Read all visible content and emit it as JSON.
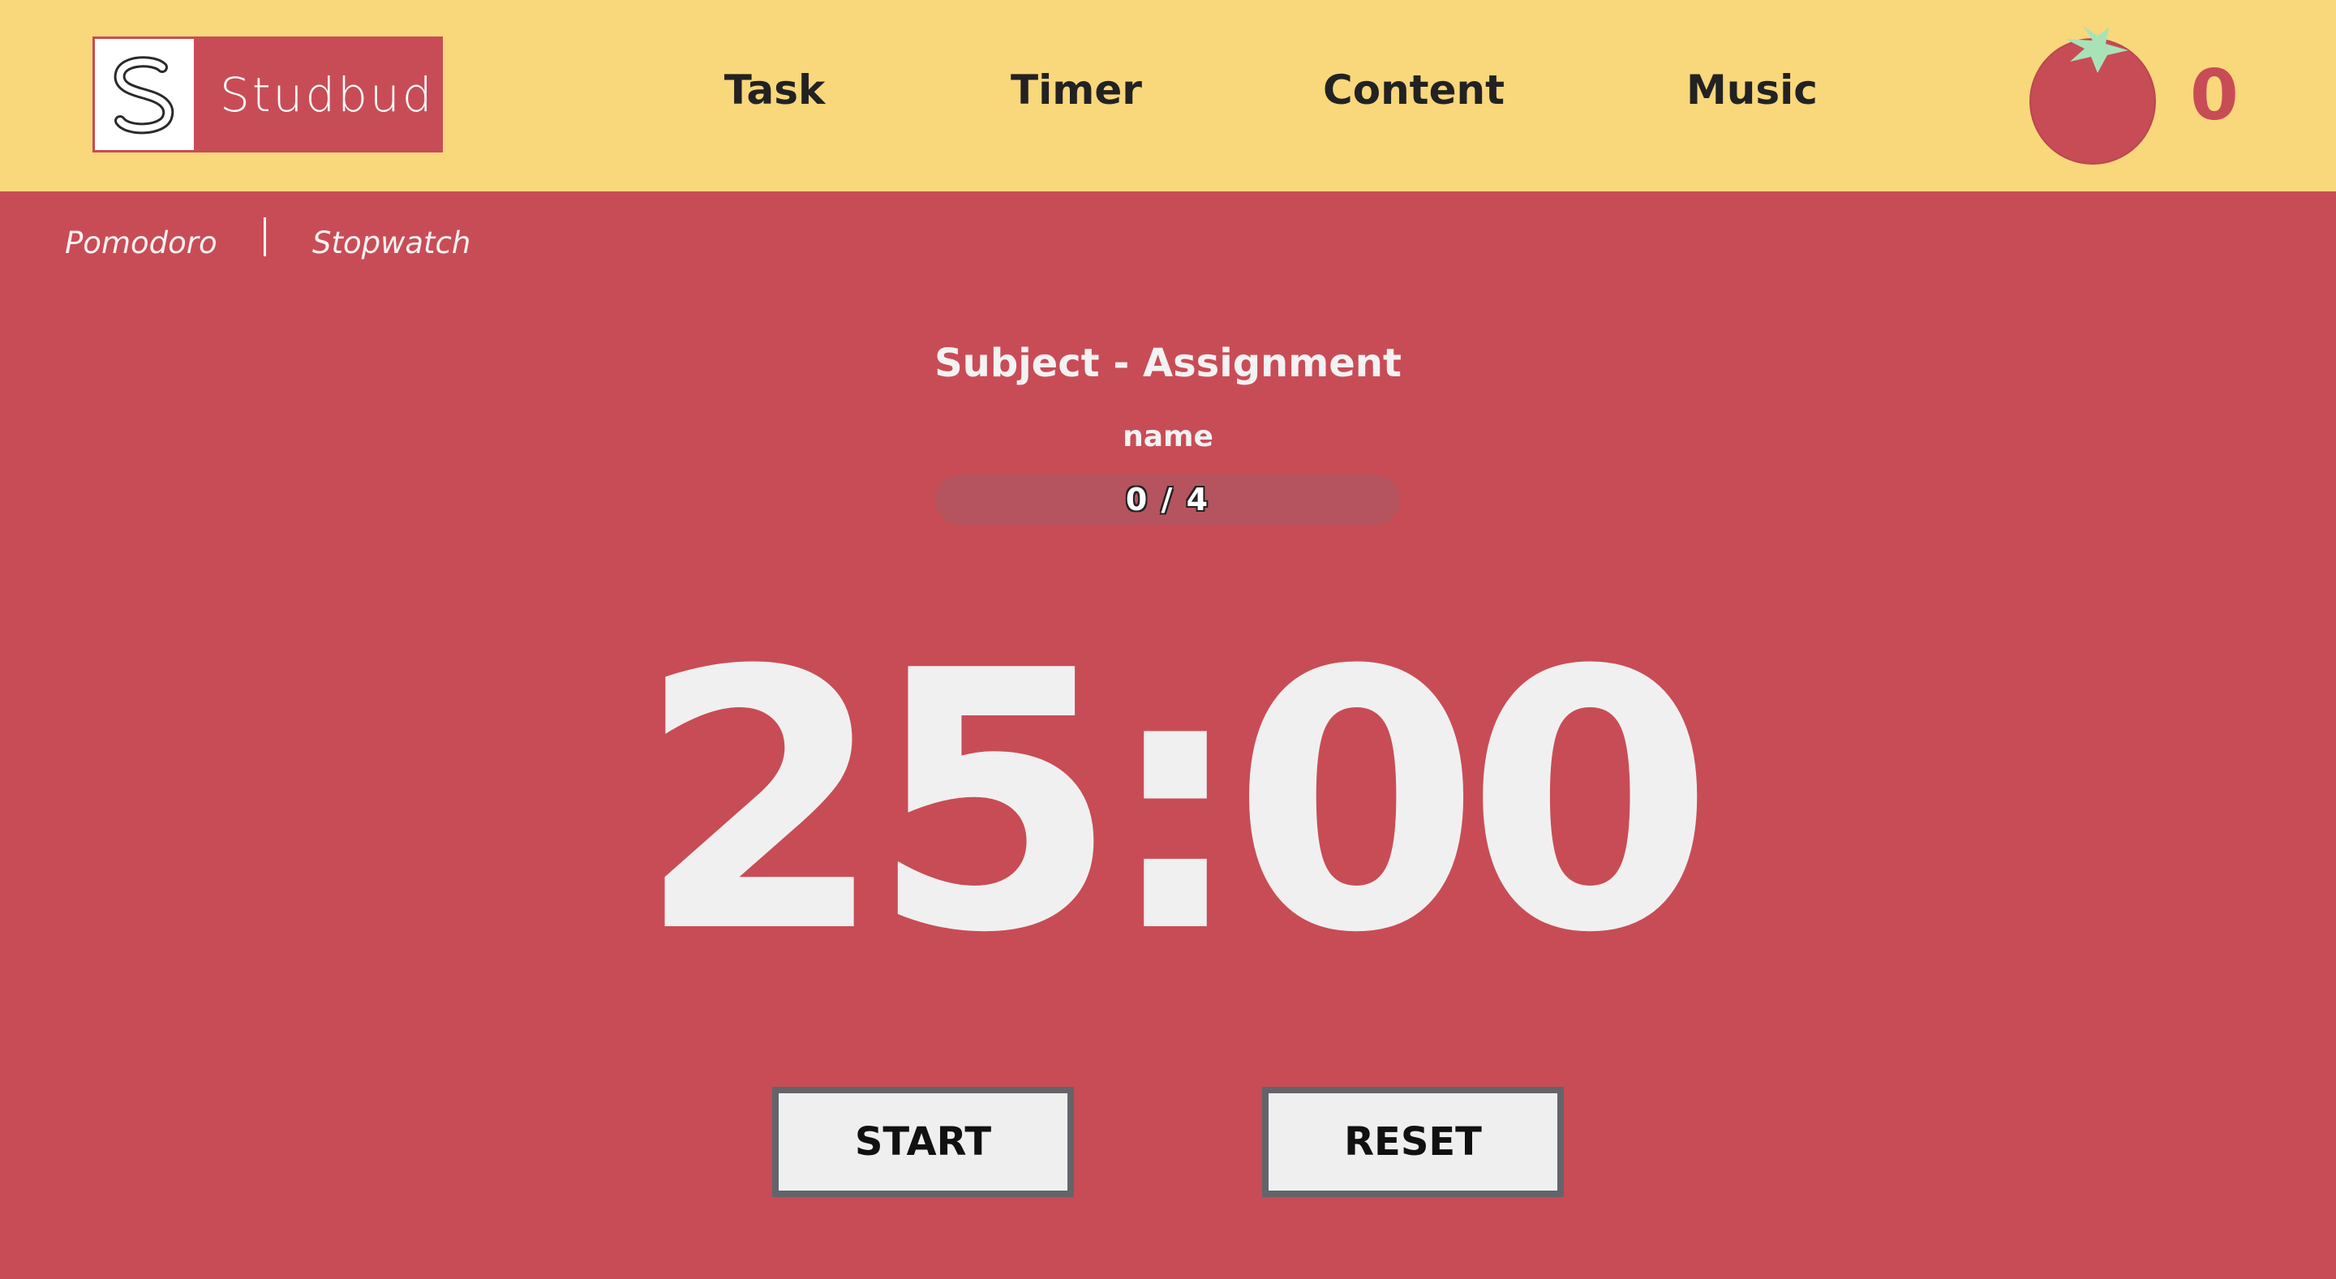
{
  "brand": {
    "name": "Studbud",
    "logo_icon": "s-loop-logo-icon"
  },
  "nav": {
    "items": [
      {
        "label": "Task"
      },
      {
        "label": "Timer"
      },
      {
        "label": "Content"
      },
      {
        "label": "Music"
      }
    ]
  },
  "pomodoro_counter": {
    "icon": "tomato-icon",
    "count": "0"
  },
  "modes": {
    "items": [
      {
        "label": "Pomodoro"
      },
      {
        "label": "Stopwatch"
      }
    ]
  },
  "task": {
    "title": "Subject - Assignment",
    "name": "name",
    "progress_label": "0 / 4",
    "progress_fraction": 0
  },
  "timer": {
    "display": "25:00"
  },
  "controls": {
    "start_label": "START",
    "reset_label": "RESET"
  },
  "colors": {
    "header_bg": "#f9d77b",
    "page_bg": "#c84c56",
    "accent_red": "#c84c56",
    "nav_text": "#222222",
    "button_border": "#63646a",
    "tomato_leaf": "#a8e3b8"
  }
}
